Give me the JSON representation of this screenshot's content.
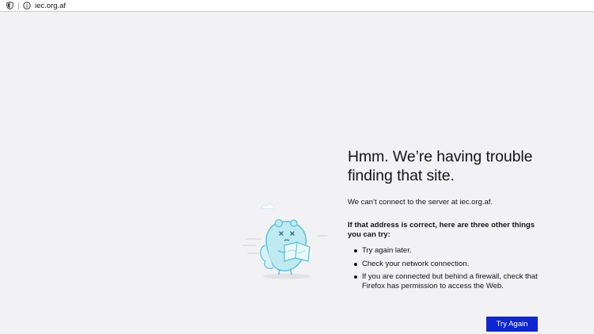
{
  "urlbar": {
    "url": "iec.org.af",
    "shield_icon": "tracking-shield-icon",
    "info_icon": "info-icon"
  },
  "error": {
    "title_line1": "Hmm. We’re having trouble",
    "title_line2": "finding that site.",
    "description": "We can’t connect to the server at iec.org.af.",
    "suggestions_heading": "If that address is correct, here are three other things you can try:",
    "suggestions": [
      "Try again later.",
      "Check your network connection.",
      "If you are connected but behind a firewall, check that Firefox has permission to access the Web."
    ],
    "try_again_label": "Try Again"
  },
  "illustration": {
    "name": "sad-puzzle-mascot-illustration",
    "accent_color": "#7fd6e6"
  },
  "colors": {
    "page_background": "#f2f2f4",
    "button_background": "#0c27d2",
    "text": "#15141a"
  }
}
